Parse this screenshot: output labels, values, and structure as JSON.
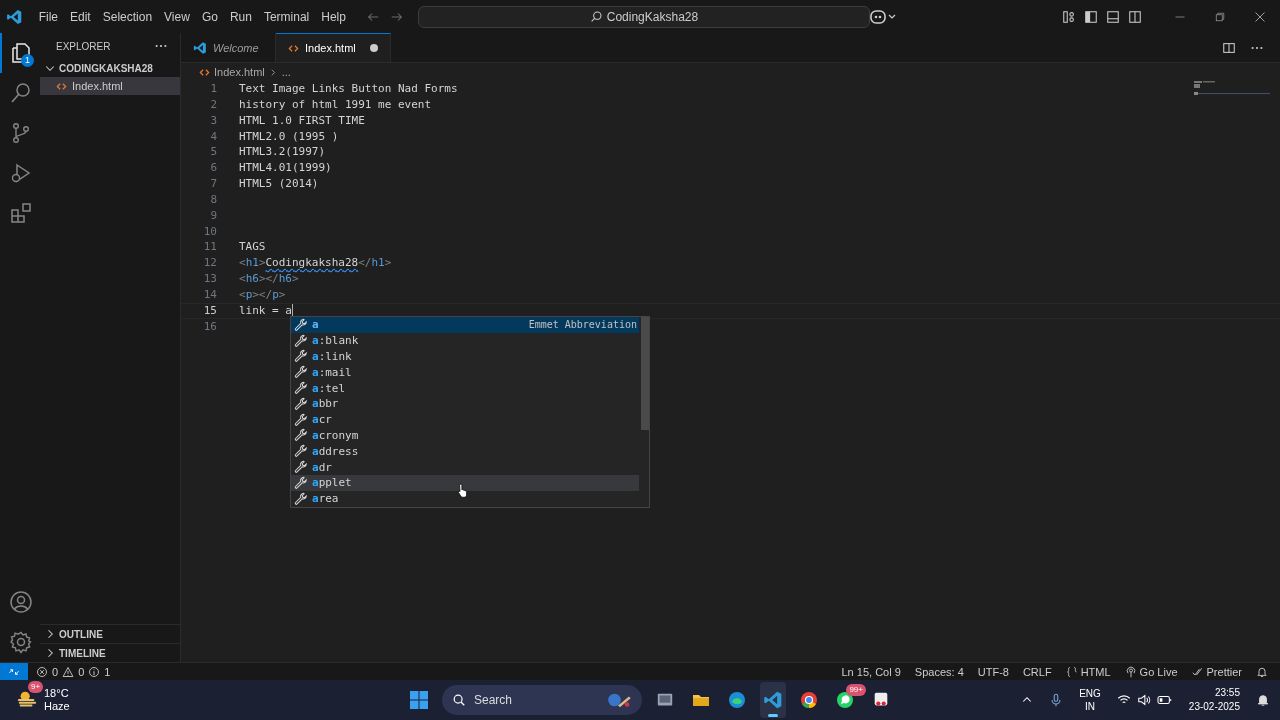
{
  "menu": [
    "File",
    "Edit",
    "Selection",
    "View",
    "Go",
    "Run",
    "Terminal",
    "Help"
  ],
  "command_center": {
    "text": "CodingKaksha28"
  },
  "activity_bar": {
    "items": [
      {
        "kind": "explorer",
        "selected": true,
        "badge": "1"
      },
      {
        "kind": "search",
        "selected": false
      },
      {
        "kind": "source-control",
        "selected": false
      },
      {
        "kind": "run",
        "selected": false
      },
      {
        "kind": "extensions",
        "selected": false
      }
    ],
    "bottom": [
      {
        "kind": "account"
      },
      {
        "kind": "settings"
      }
    ]
  },
  "sidebar": {
    "title": "EXPLORER",
    "folder": {
      "label": "CODINGKAKSHA28",
      "expanded": true,
      "children": [
        {
          "label": "Index.html",
          "selected": true
        }
      ]
    },
    "sections": [
      {
        "label": "OUTLINE",
        "expanded": false
      },
      {
        "label": "TIMELINE",
        "expanded": false
      }
    ]
  },
  "tabs": [
    {
      "label": "Welcome",
      "kind": "welcome",
      "selected": false,
      "dirty": false
    },
    {
      "label": "Index.html",
      "kind": "html",
      "selected": true,
      "dirty": true
    }
  ],
  "breadcrumb": [
    "Index.html",
    "..."
  ],
  "code": {
    "lines": [
      {
        "number": "1",
        "current": false,
        "tokens": [
          {
            "kind": "text",
            "text": "Text Image Links Button Nad Forms"
          }
        ]
      },
      {
        "number": "2",
        "current": false,
        "tokens": [
          {
            "kind": "text",
            "text": "history of html 1991 me event"
          }
        ]
      },
      {
        "number": "3",
        "current": false,
        "tokens": [
          {
            "kind": "text",
            "text": "HTML 1.0 FIRST TIME"
          }
        ]
      },
      {
        "number": "4",
        "current": false,
        "tokens": [
          {
            "kind": "text",
            "text": "HTML2.0 (1995 )"
          }
        ]
      },
      {
        "number": "5",
        "current": false,
        "tokens": [
          {
            "kind": "text",
            "text": "HTML3.2(1997)"
          }
        ]
      },
      {
        "number": "6",
        "current": false,
        "tokens": [
          {
            "kind": "text",
            "text": "HTML4.01(1999)"
          }
        ]
      },
      {
        "number": "7",
        "current": false,
        "tokens": [
          {
            "kind": "text",
            "text": "HTML5 (2014)"
          }
        ]
      },
      {
        "number": "8",
        "current": false
      },
      {
        "number": "9",
        "current": false
      },
      {
        "number": "10",
        "current": false
      },
      {
        "number": "11",
        "current": false,
        "tokens": [
          {
            "kind": "text",
            "text": "TAGS"
          }
        ]
      },
      {
        "number": "12",
        "current": false,
        "tokens": [
          {
            "kind": "punct",
            "text": "<"
          },
          {
            "kind": "tag",
            "text": "h1"
          },
          {
            "kind": "punct",
            "text": ">"
          },
          {
            "kind": "misspelled",
            "text": "Codingkaksha28"
          },
          {
            "kind": "punct",
            "text": "</"
          },
          {
            "kind": "tag",
            "text": "h1"
          },
          {
            "kind": "punct",
            "text": ">"
          }
        ]
      },
      {
        "number": "13",
        "current": false,
        "tokens": [
          {
            "kind": "punct",
            "text": "<"
          },
          {
            "kind": "tag",
            "text": "h6"
          },
          {
            "kind": "punct",
            "text": "></"
          },
          {
            "kind": "tag",
            "text": "h6"
          },
          {
            "kind": "punct",
            "text": ">"
          }
        ]
      },
      {
        "number": "14",
        "current": false,
        "tokens": [
          {
            "kind": "punct",
            "text": "<"
          },
          {
            "kind": "tag",
            "text": "p"
          },
          {
            "kind": "punct",
            "text": "></"
          },
          {
            "kind": "tag",
            "text": "p"
          },
          {
            "kind": "punct",
            "text": ">"
          }
        ]
      },
      {
        "number": "15",
        "current": true,
        "tokens": [
          {
            "kind": "text",
            "text": "link = a"
          }
        ]
      },
      {
        "number": "16",
        "current": false
      }
    ]
  },
  "suggestions": [
    {
      "match": "a",
      "detail": "Emmet Abbreviation",
      "selected": true,
      "hovered": false
    },
    {
      "match": "a",
      "rest": ":blank",
      "selected": false,
      "hovered": false
    },
    {
      "match": "a",
      "rest": ":link",
      "selected": false,
      "hovered": false
    },
    {
      "match": "a",
      "rest": ":mail",
      "selected": false,
      "hovered": false
    },
    {
      "match": "a",
      "rest": ":tel",
      "selected": false,
      "hovered": false
    },
    {
      "match": "a",
      "rest": "bbr",
      "selected": false,
      "hovered": false
    },
    {
      "match": "a",
      "rest": "cr",
      "selected": false,
      "hovered": false
    },
    {
      "match": "a",
      "rest": "cronym",
      "selected": false,
      "hovered": false
    },
    {
      "match": "a",
      "rest": "ddress",
      "selected": false,
      "hovered": false
    },
    {
      "match": "a",
      "rest": "dr",
      "selected": false,
      "hovered": false
    },
    {
      "match": "a",
      "rest": "pplet",
      "selected": false,
      "hovered": true
    },
    {
      "match": "a",
      "rest": "rea",
      "selected": false,
      "hovered": false
    }
  ],
  "status_bar": {
    "left": [
      {
        "kind": "errors",
        "text": "0"
      },
      {
        "kind": "warnings",
        "text": "0"
      },
      {
        "kind": "info",
        "text": "1"
      }
    ],
    "right": [
      {
        "kind": "text",
        "text": "Ln 15, Col 9"
      },
      {
        "kind": "text",
        "text": "Spaces: 4"
      },
      {
        "kind": "text",
        "text": "UTF-8"
      },
      {
        "kind": "text",
        "text": "CRLF"
      },
      {
        "kind": "language",
        "text": "HTML"
      },
      {
        "kind": "live",
        "text": "Go Live"
      },
      {
        "kind": "prettier",
        "text": "Prettier"
      },
      {
        "kind": "bell"
      }
    ]
  },
  "taskbar": {
    "weather": {
      "badge": "9+",
      "temperature": "18°C",
      "condition": "Haze"
    },
    "search": {
      "placeholder": "Search"
    },
    "apps": [
      {
        "kind": "start",
        "active": false
      },
      {
        "kind": "files",
        "active": false
      },
      {
        "kind": "folder",
        "active": false
      },
      {
        "kind": "browser",
        "active": false
      },
      {
        "kind": "editor",
        "active": true
      },
      {
        "kind": "chrome",
        "active": false
      },
      {
        "kind": "chat",
        "active": false,
        "badge": "99+"
      },
      {
        "kind": "snip",
        "active": false
      }
    ],
    "tray": {
      "language": "ENG",
      "region": "IN",
      "time": "23:55",
      "date": "23-02-2025"
    }
  }
}
